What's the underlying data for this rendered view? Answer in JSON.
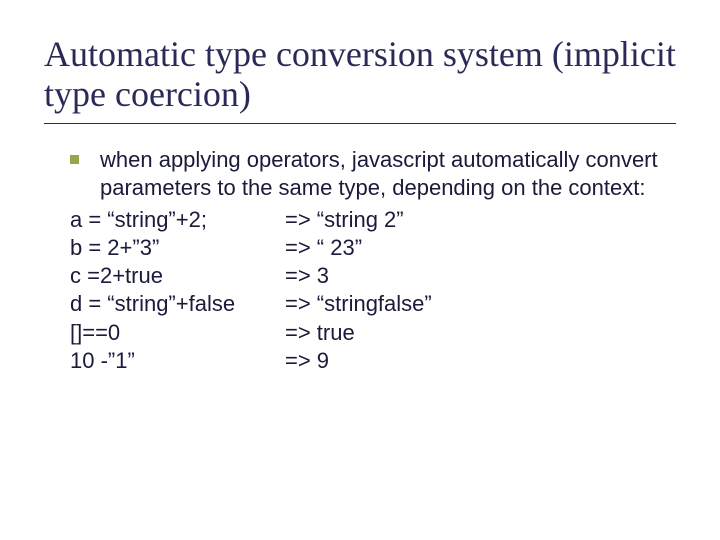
{
  "title": "Automatic type conversion system (implicit type coercion)",
  "intro": "when applying operators, javascript automatically convert parameters to the same type, depending on the context:",
  "examples": [
    {
      "lhs": "a = “string”+2;",
      "rhs": "=> “string 2”"
    },
    {
      "lhs": "b = 2+”3”",
      "rhs": "=> “ 23”"
    },
    {
      "lhs": "c =2+true",
      "rhs": "=> 3"
    },
    {
      "lhs": "d = “string”+false",
      "rhs": "=> “stringfalse”"
    },
    {
      "lhs": "[]==0",
      "rhs": "=> true"
    },
    {
      "lhs": "10 -”1”",
      "rhs": "=> 9"
    }
  ]
}
